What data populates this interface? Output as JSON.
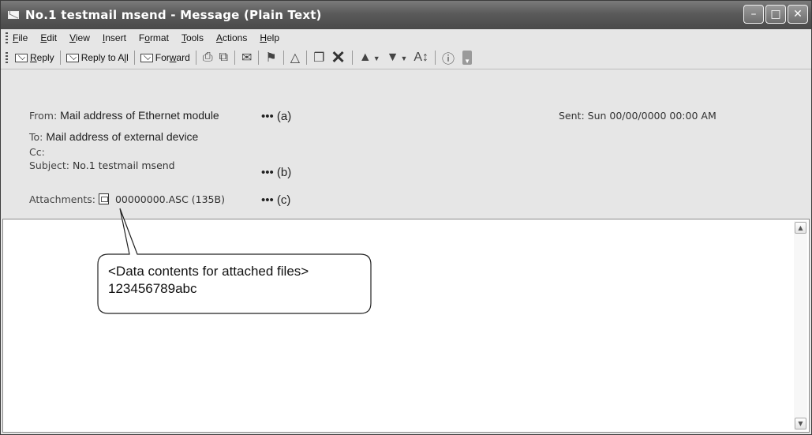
{
  "window": {
    "title": "No.1 testmail msend - Message (Plain Text)"
  },
  "menu": [
    {
      "pre": "",
      "u": "F",
      "post": "ile"
    },
    {
      "pre": "",
      "u": "E",
      "post": "dit"
    },
    {
      "pre": "",
      "u": "V",
      "post": "iew"
    },
    {
      "pre": "",
      "u": "I",
      "post": "nsert"
    },
    {
      "pre": "F",
      "u": "o",
      "post": "rmat"
    },
    {
      "pre": "",
      "u": "T",
      "post": "ools"
    },
    {
      "pre": "",
      "u": "A",
      "post": "ctions"
    },
    {
      "pre": "",
      "u": "H",
      "post": "elp"
    }
  ],
  "toolbar": {
    "reply": {
      "pre": "",
      "u": "R",
      "post": "eply"
    },
    "reply_all": {
      "pre": "Reply to A",
      "u": "l",
      "post": "l"
    },
    "forward": {
      "pre": "For",
      "u": "w",
      "post": "ard"
    },
    "font_glyph": "A↕"
  },
  "header": {
    "from_label": "From:",
    "from_value": "Mail address of Ethernet module",
    "to_label": "To:",
    "to_value": "Mail address of external device",
    "cc_label": "Cc:",
    "subject_label": "Subject:",
    "subject_value": "No.1 testmail msend",
    "attachments_label": "Attachments:",
    "attachment_value": "00000000.ASC (135B)",
    "sent": "Sent: Sun 00/00/0000 00:00 AM"
  },
  "markers": {
    "a": "••• (a)",
    "b": "••• (b)",
    "c": "••• (c)"
  },
  "callout": {
    "line1": "<Data contents for attached files>",
    "line2": "123456789abc"
  }
}
